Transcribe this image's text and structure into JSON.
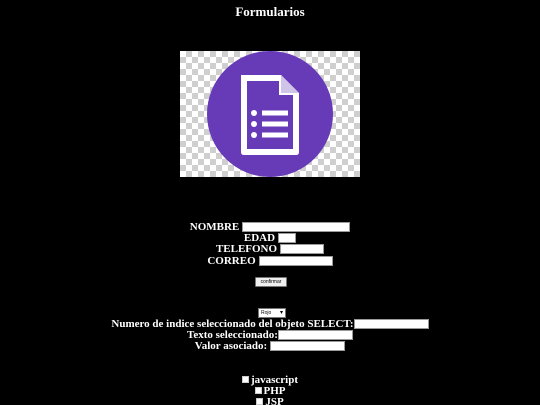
{
  "page": {
    "title": "Formularios"
  },
  "logo": {
    "icon": "google-forms-icon",
    "color": "#673ab7"
  },
  "form": {
    "nombre_label": "NOMBRE",
    "edad_label": "EDAD",
    "telefono_label": "TELEFONO",
    "correo_label": "CORREO",
    "nombre_value": "",
    "edad_value": "",
    "telefono_value": "",
    "correo_value": "",
    "confirm_label": "confirmar"
  },
  "select": {
    "selected": "Rojo",
    "indice_label": "Numero de indice seleccionado del objeto SELECT:",
    "texto_label": "Texto seleccionado:",
    "valor_label": "Valor asociado:",
    "indice_value": "",
    "texto_value": "",
    "valor_value": ""
  },
  "checkboxes": [
    {
      "label": "javascript",
      "checked": false
    },
    {
      "label": "PHP",
      "checked": false
    },
    {
      "label": "JSP",
      "checked": false
    }
  ]
}
